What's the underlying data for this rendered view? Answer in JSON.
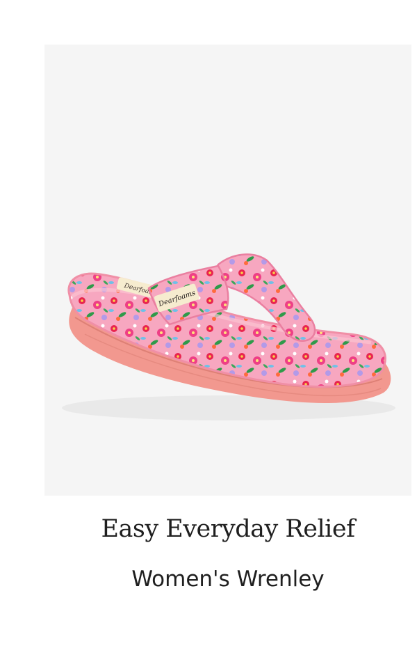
{
  "card": {
    "headline": "Easy Everyday Relief",
    "product_name": "Women's Wrenley",
    "image": {
      "subject": "pink floral terry thong slipper",
      "brand_mark": "Dearfoams",
      "background_color": "#f5f5f5",
      "sole_color": "#f2988f",
      "fabric_base_color": "#f7a7c0"
    }
  }
}
